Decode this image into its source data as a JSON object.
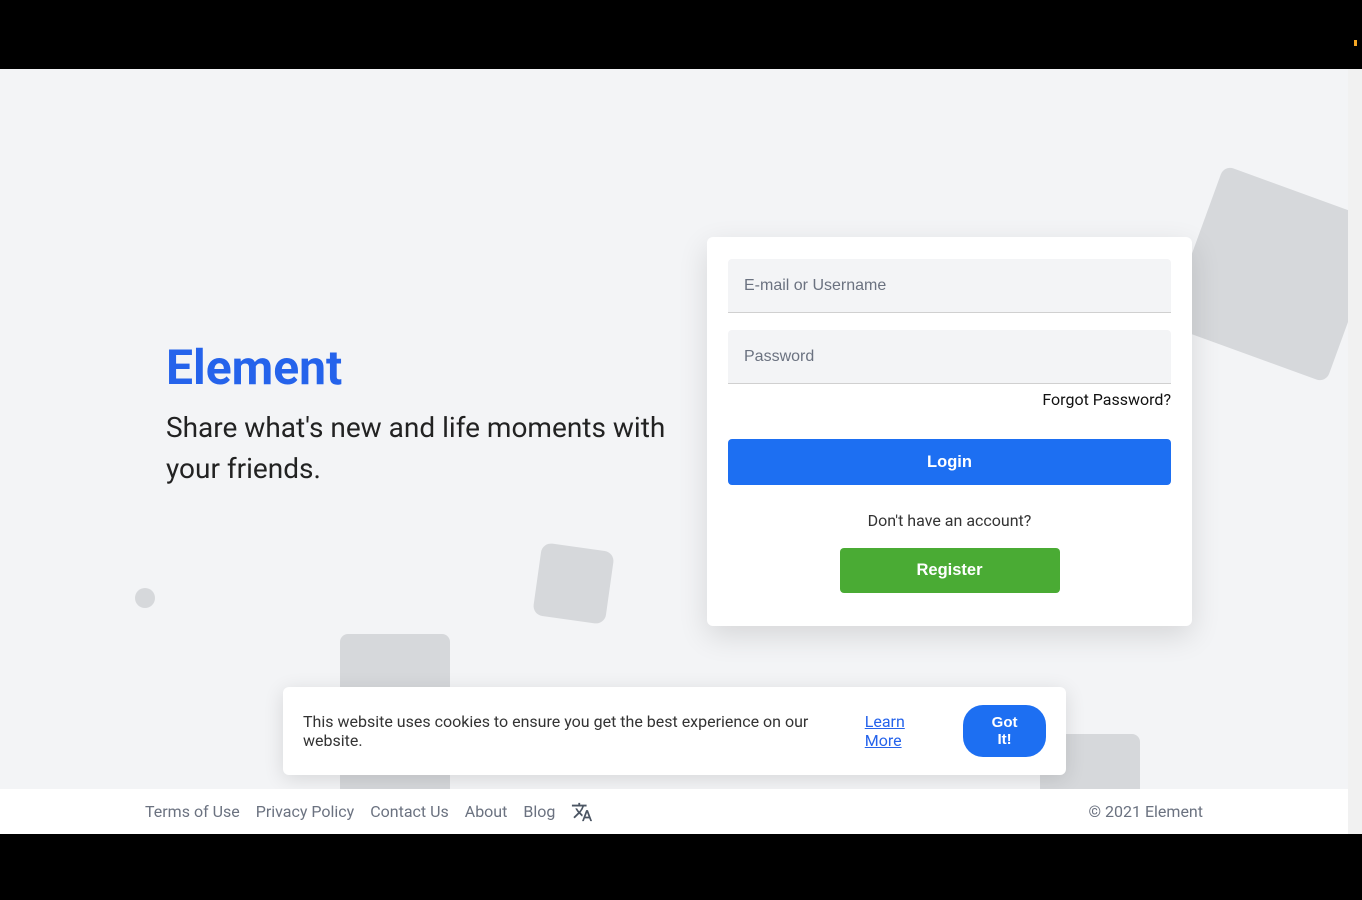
{
  "hero": {
    "title": "Element",
    "subtitle": "Share what's new and life moments with your friends."
  },
  "login": {
    "email_placeholder": "E-mail or Username",
    "password_placeholder": "Password",
    "forgot": "Forgot Password?",
    "login_button": "Login",
    "no_account": "Don't have an account?",
    "register_button": "Register"
  },
  "cookie": {
    "text": "This website uses cookies to ensure you get the best experience on our website.",
    "learn_more": "Learn More",
    "got_it": "Got It!"
  },
  "footer": {
    "links": [
      "Terms of Use",
      "Privacy Policy",
      "Contact Us",
      "About",
      "Blog"
    ],
    "copyright": "© 2021 Element"
  }
}
